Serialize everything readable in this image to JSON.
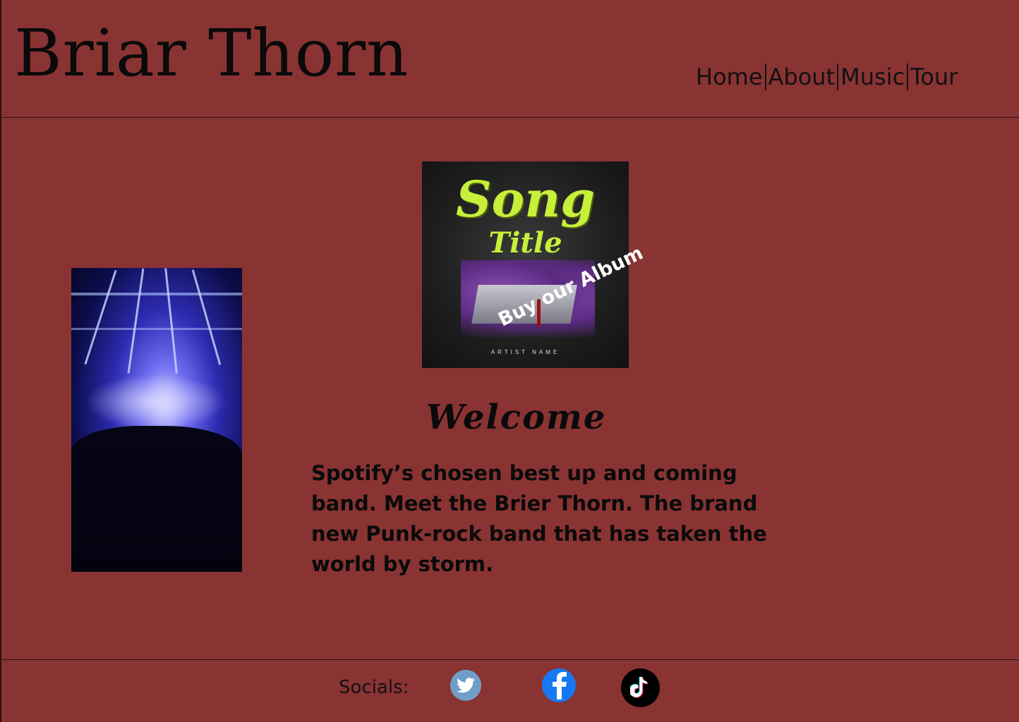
{
  "header": {
    "brand": "Briar Thorn",
    "nav": [
      "Home",
      "About",
      "Music",
      "Tour"
    ]
  },
  "album": {
    "title": "Song",
    "subtitle": "Title",
    "artist": "ARTIST NAME",
    "buy_label": "Buy our Album"
  },
  "main": {
    "welcome": "Welcome",
    "blurb": "Spotify’s chosen best up and coming band. Meet the Brier Thorn. The brand new Punk-rock band that has taken the world by storm."
  },
  "footer": {
    "socials_label": "Socials:",
    "icons": [
      "twitter-icon",
      "facebook-icon",
      "tiktok-icon"
    ]
  },
  "colors": {
    "background": "#8a3333",
    "album_accent": "#c6f03a",
    "facebook": "#1877f2",
    "twitter": "#6f9ec8"
  }
}
